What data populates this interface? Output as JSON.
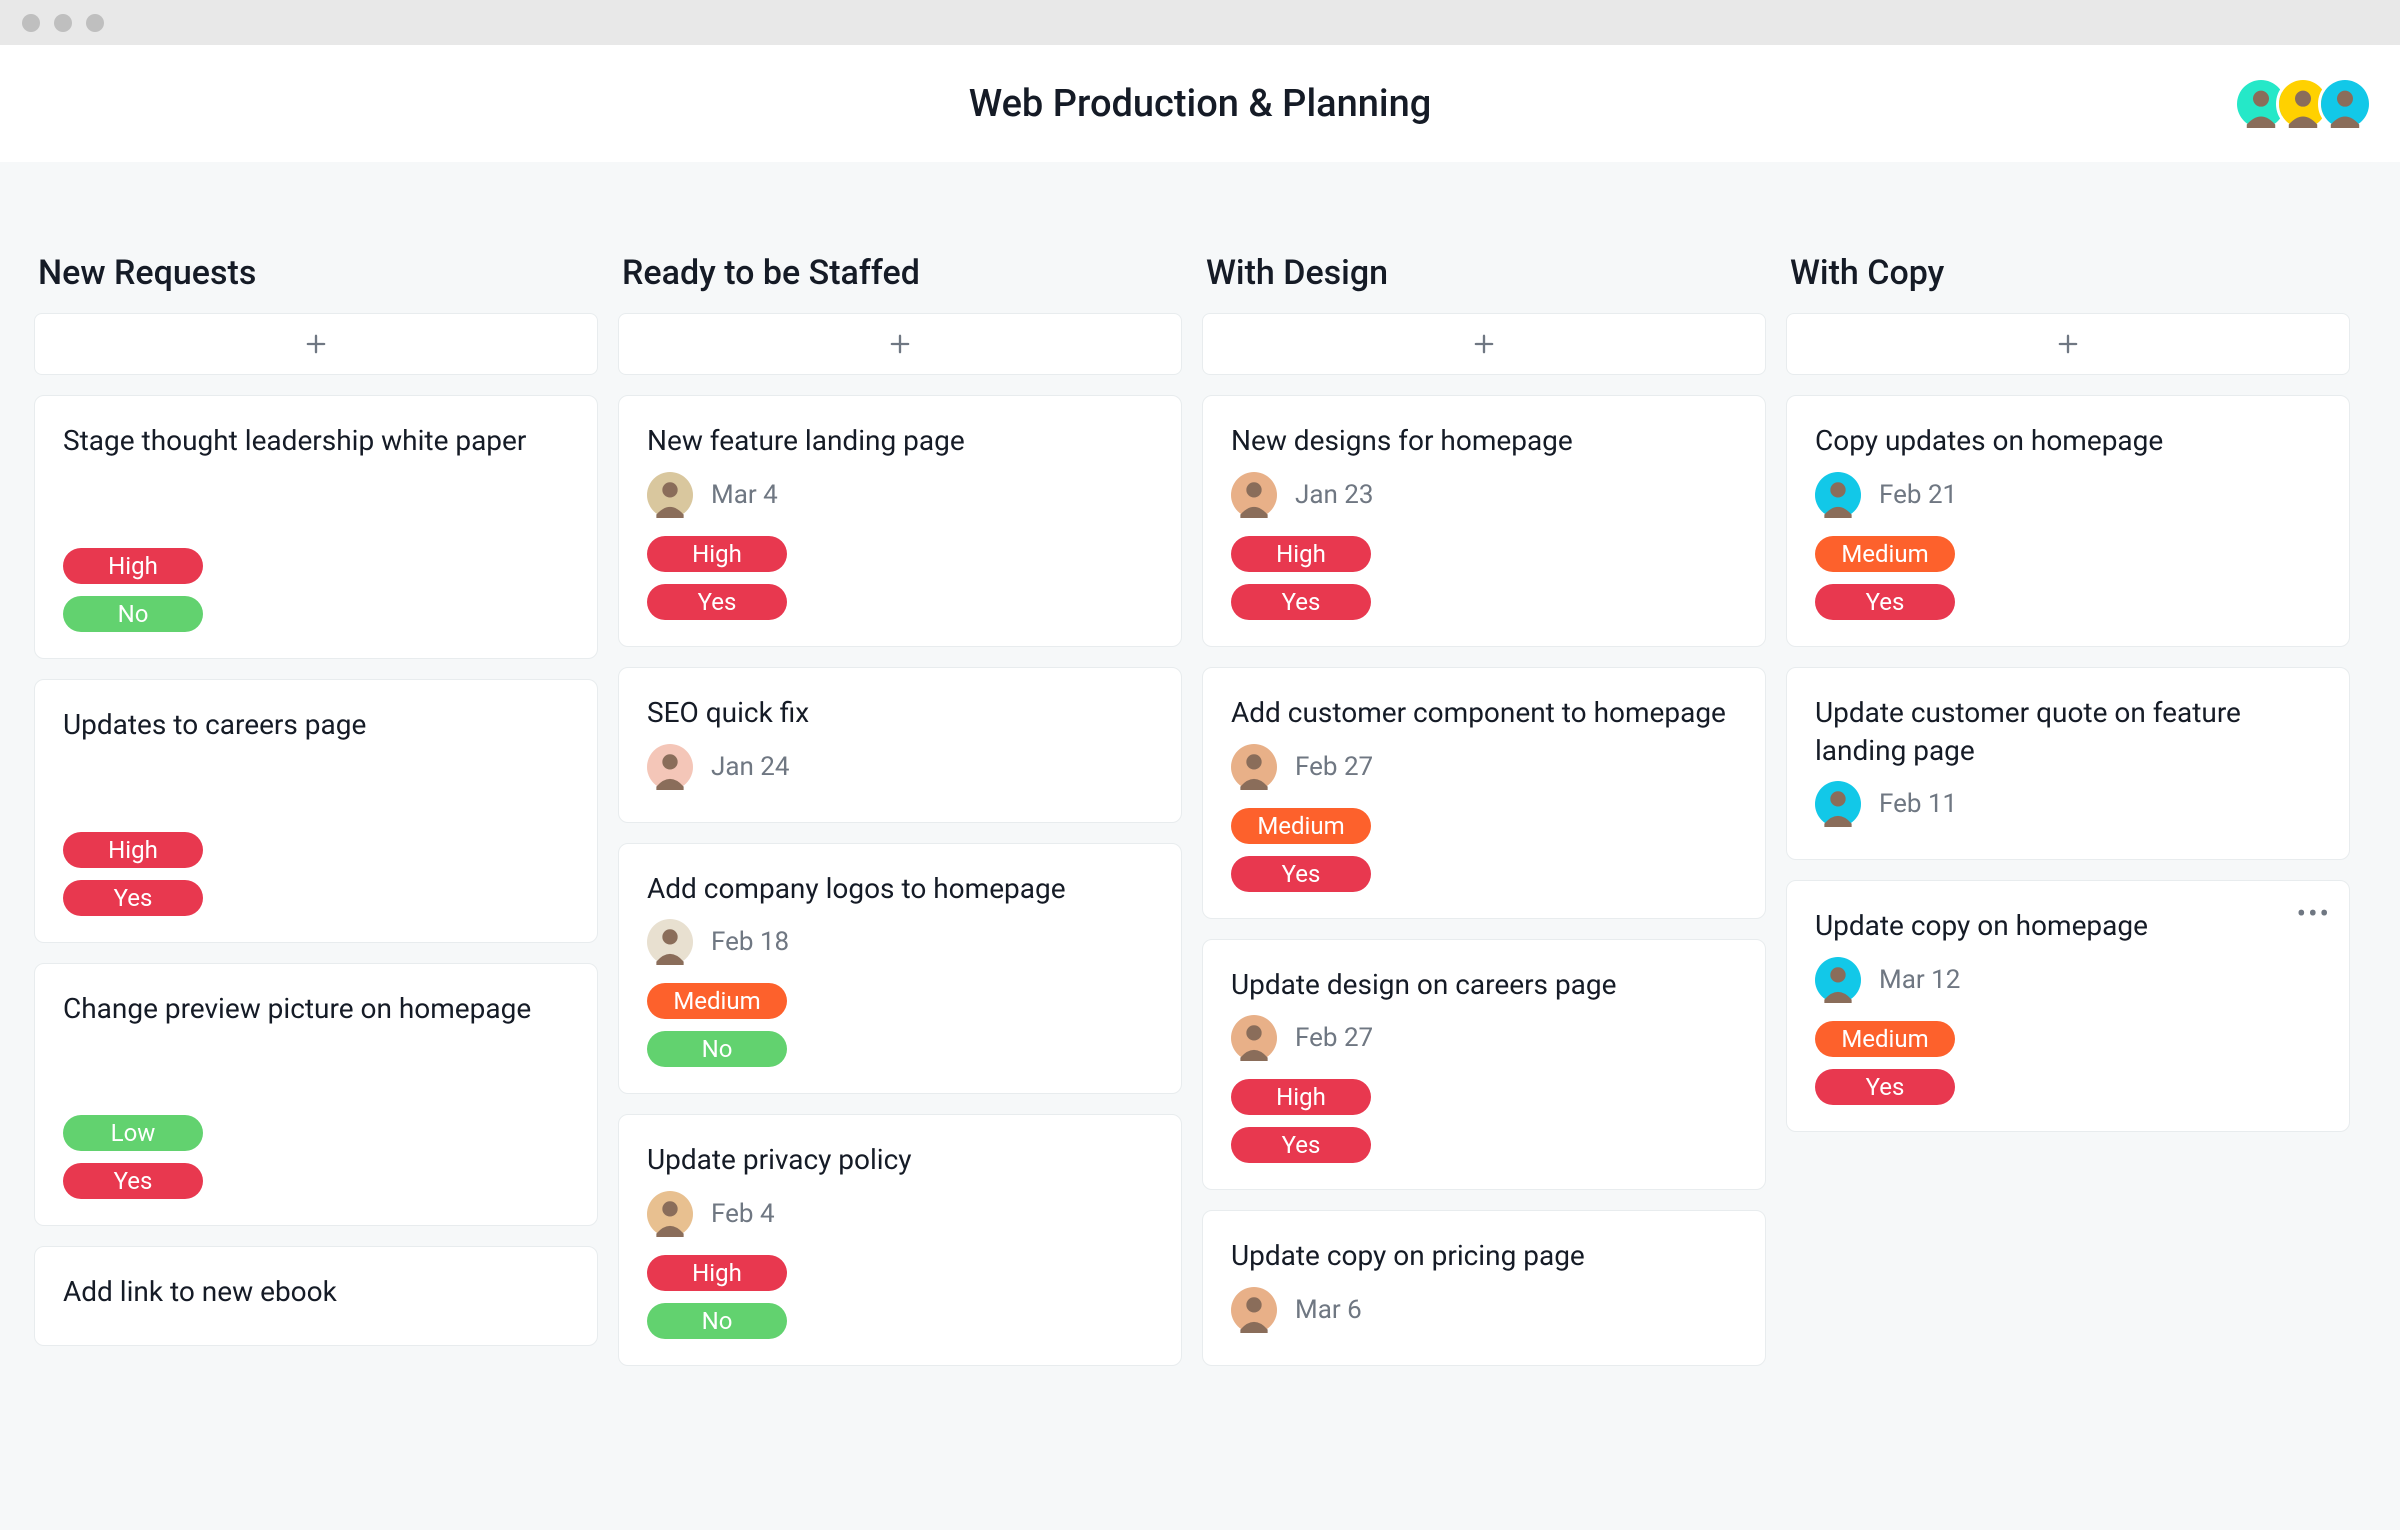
{
  "header": {
    "title": "Web Production & Planning"
  },
  "collaborators": [
    {
      "bg": "#25e8c8"
    },
    {
      "bg": "#ffd100"
    },
    {
      "bg": "#12c8e8"
    }
  ],
  "columns": [
    {
      "title": "New Requests",
      "cards": [
        {
          "title": "Stage thought leadership white paper",
          "assignee": null,
          "due": null,
          "tags": [
            "High",
            "No"
          ],
          "spacer": true
        },
        {
          "title": "Updates to careers page",
          "assignee": null,
          "due": null,
          "tags": [
            "High",
            "Yes"
          ],
          "spacer": true
        },
        {
          "title": "Change preview picture on homepage",
          "assignee": null,
          "due": null,
          "tags": [
            "Low",
            "Yes"
          ],
          "spacer": true
        },
        {
          "title": "Add link to new ebook",
          "assignee": null,
          "due": null,
          "tags": []
        }
      ]
    },
    {
      "title": "Ready to be Staffed",
      "cards": [
        {
          "title": "New feature landing page",
          "assignee": {
            "bg": "#d9c79e"
          },
          "due": "Mar 4",
          "tags": [
            "High",
            "Yes"
          ]
        },
        {
          "title": "SEO quick fix",
          "assignee": {
            "bg": "#f4c6b8"
          },
          "due": "Jan 24",
          "tags": []
        },
        {
          "title": "Add company logos to homepage",
          "assignee": {
            "bg": "#e8e0d0"
          },
          "due": "Feb 18",
          "tags": [
            "Medium",
            "No"
          ]
        },
        {
          "title": "Update privacy policy",
          "assignee": {
            "bg": "#e8c090"
          },
          "due": "Feb 4",
          "tags": [
            "High",
            "No"
          ]
        }
      ]
    },
    {
      "title": "With Design",
      "cards": [
        {
          "title": "New designs for homepage",
          "assignee": {
            "bg": "#e8b088"
          },
          "due": "Jan 23",
          "tags": [
            "High",
            "Yes"
          ]
        },
        {
          "title": "Add customer component to homepage",
          "assignee": {
            "bg": "#e8b088"
          },
          "due": "Feb 27",
          "tags": [
            "Medium",
            "Yes"
          ]
        },
        {
          "title": "Update design on careers page",
          "assignee": {
            "bg": "#e8b088"
          },
          "due": "Feb 27",
          "tags": [
            "High",
            "Yes"
          ]
        },
        {
          "title": "Update copy on pricing page",
          "assignee": {
            "bg": "#e8b088"
          },
          "due": "Mar 6",
          "tags": []
        }
      ]
    },
    {
      "title": "With Copy",
      "cards": [
        {
          "title": "Copy updates on homepage",
          "assignee": {
            "bg": "#12c8e8"
          },
          "due": "Feb 21",
          "tags": [
            "Medium",
            "Yes"
          ]
        },
        {
          "title": "Update customer quote on feature landing page",
          "assignee": {
            "bg": "#12c8e8"
          },
          "due": "Feb 11",
          "tags": []
        },
        {
          "title": "Update copy on homepage",
          "assignee": {
            "bg": "#12c8e8"
          },
          "due": "Mar 12",
          "tags": [
            "Medium",
            "Yes"
          ],
          "menu": true
        }
      ]
    }
  ]
}
